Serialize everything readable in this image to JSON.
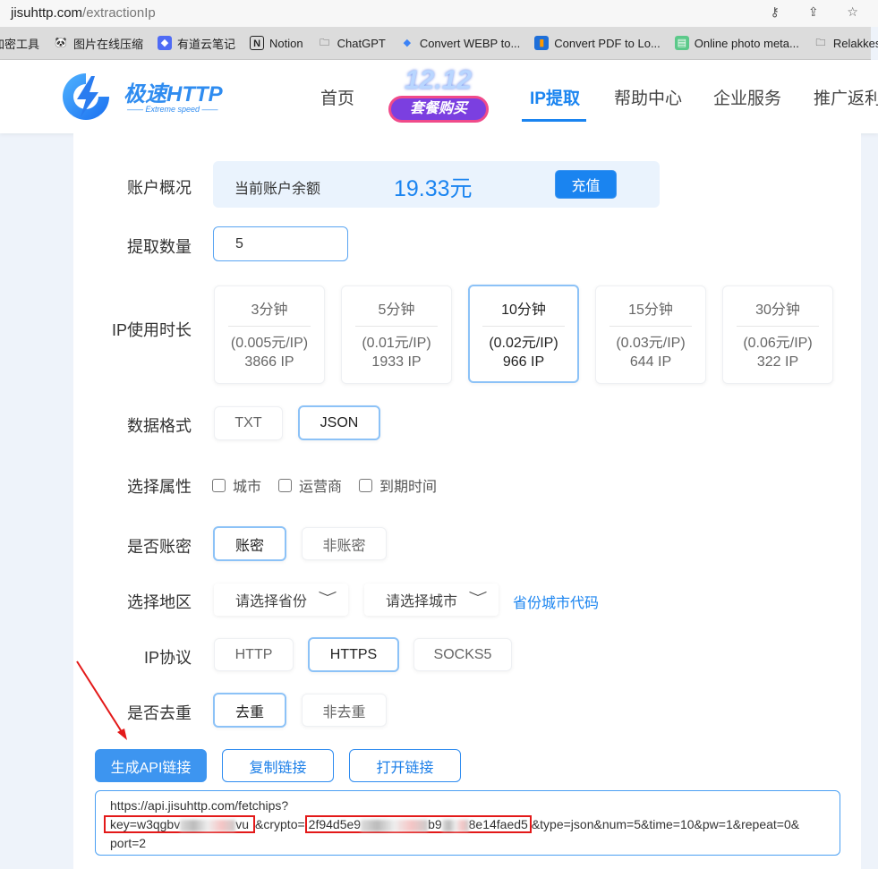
{
  "browser": {
    "url_domain": "jisuhttp.com",
    "url_path": "/extractionIp",
    "bookmarks": [
      "加密工具",
      "图片在线压缩",
      "有道云笔记",
      "Notion",
      "ChatGPT",
      "Convert WEBP to...",
      "Convert PDF to Lo...",
      "Online photo meta...",
      "Relakkes"
    ]
  },
  "header": {
    "brand": "极速HTTP",
    "brand_sub": "Extreme speed",
    "promo_top": "12.12",
    "promo_label": "套餐购买",
    "nav": [
      "首页",
      "IP提取",
      "帮助中心",
      "企业服务",
      "推广返利"
    ],
    "active_nav": "IP提取"
  },
  "form": {
    "account": {
      "label": "账户概况",
      "balance_label": "当前账户余额",
      "balance": "19.33元",
      "recharge": "充值"
    },
    "quantity": {
      "label": "提取数量",
      "value": "5"
    },
    "duration": {
      "label": "IP使用时长",
      "selected": "10分钟",
      "options": [
        {
          "time": "3分钟",
          "price": "(0.005元/IP)",
          "count": "3866 IP"
        },
        {
          "time": "5分钟",
          "price": "(0.01元/IP)",
          "count": "1933 IP"
        },
        {
          "time": "10分钟",
          "price": "(0.02元/IP)",
          "count": "966 IP"
        },
        {
          "time": "15分钟",
          "price": "(0.03元/IP)",
          "count": "644 IP"
        },
        {
          "time": "30分钟",
          "price": "(0.06元/IP)",
          "count": "322 IP"
        }
      ]
    },
    "format": {
      "label": "数据格式",
      "options": [
        "TXT",
        "JSON"
      ],
      "selected": "JSON"
    },
    "attributes": {
      "label": "选择属性",
      "options": [
        "城市",
        "运营商",
        "到期时间"
      ]
    },
    "auth": {
      "label": "是否账密",
      "options": [
        "账密",
        "非账密"
      ],
      "selected": "账密"
    },
    "region": {
      "label": "选择地区",
      "province_placeholder": "请选择省份",
      "city_placeholder": "请选择城市",
      "code_link": "省份城市代码"
    },
    "protocol": {
      "label": "IP协议",
      "options": [
        "HTTP",
        "HTTPS",
        "SOCKS5"
      ],
      "selected": "HTTPS"
    },
    "dedup": {
      "label": "是否去重",
      "options": [
        "去重",
        "非去重"
      ],
      "selected": "去重"
    }
  },
  "actions": {
    "generate": "生成API链接",
    "copy": "复制链接",
    "open": "打开链接"
  },
  "api_url": {
    "line1": "https://api.jisuhttp.com/fetchips?",
    "key_start": "key=w3qgbv",
    "key_end": "vu",
    "crypto_prefix": "&crypto=",
    "crypto_start": "2f94d5e9",
    "crypto_mid": "b9",
    "crypto_end": "8e14faed5",
    "rest": "&type=json&num=5&time=10&pw=1&repeat=0&",
    "line3": "port=2"
  },
  "colors": {
    "accent": "#1a84f0",
    "highlight": "#e31919"
  }
}
